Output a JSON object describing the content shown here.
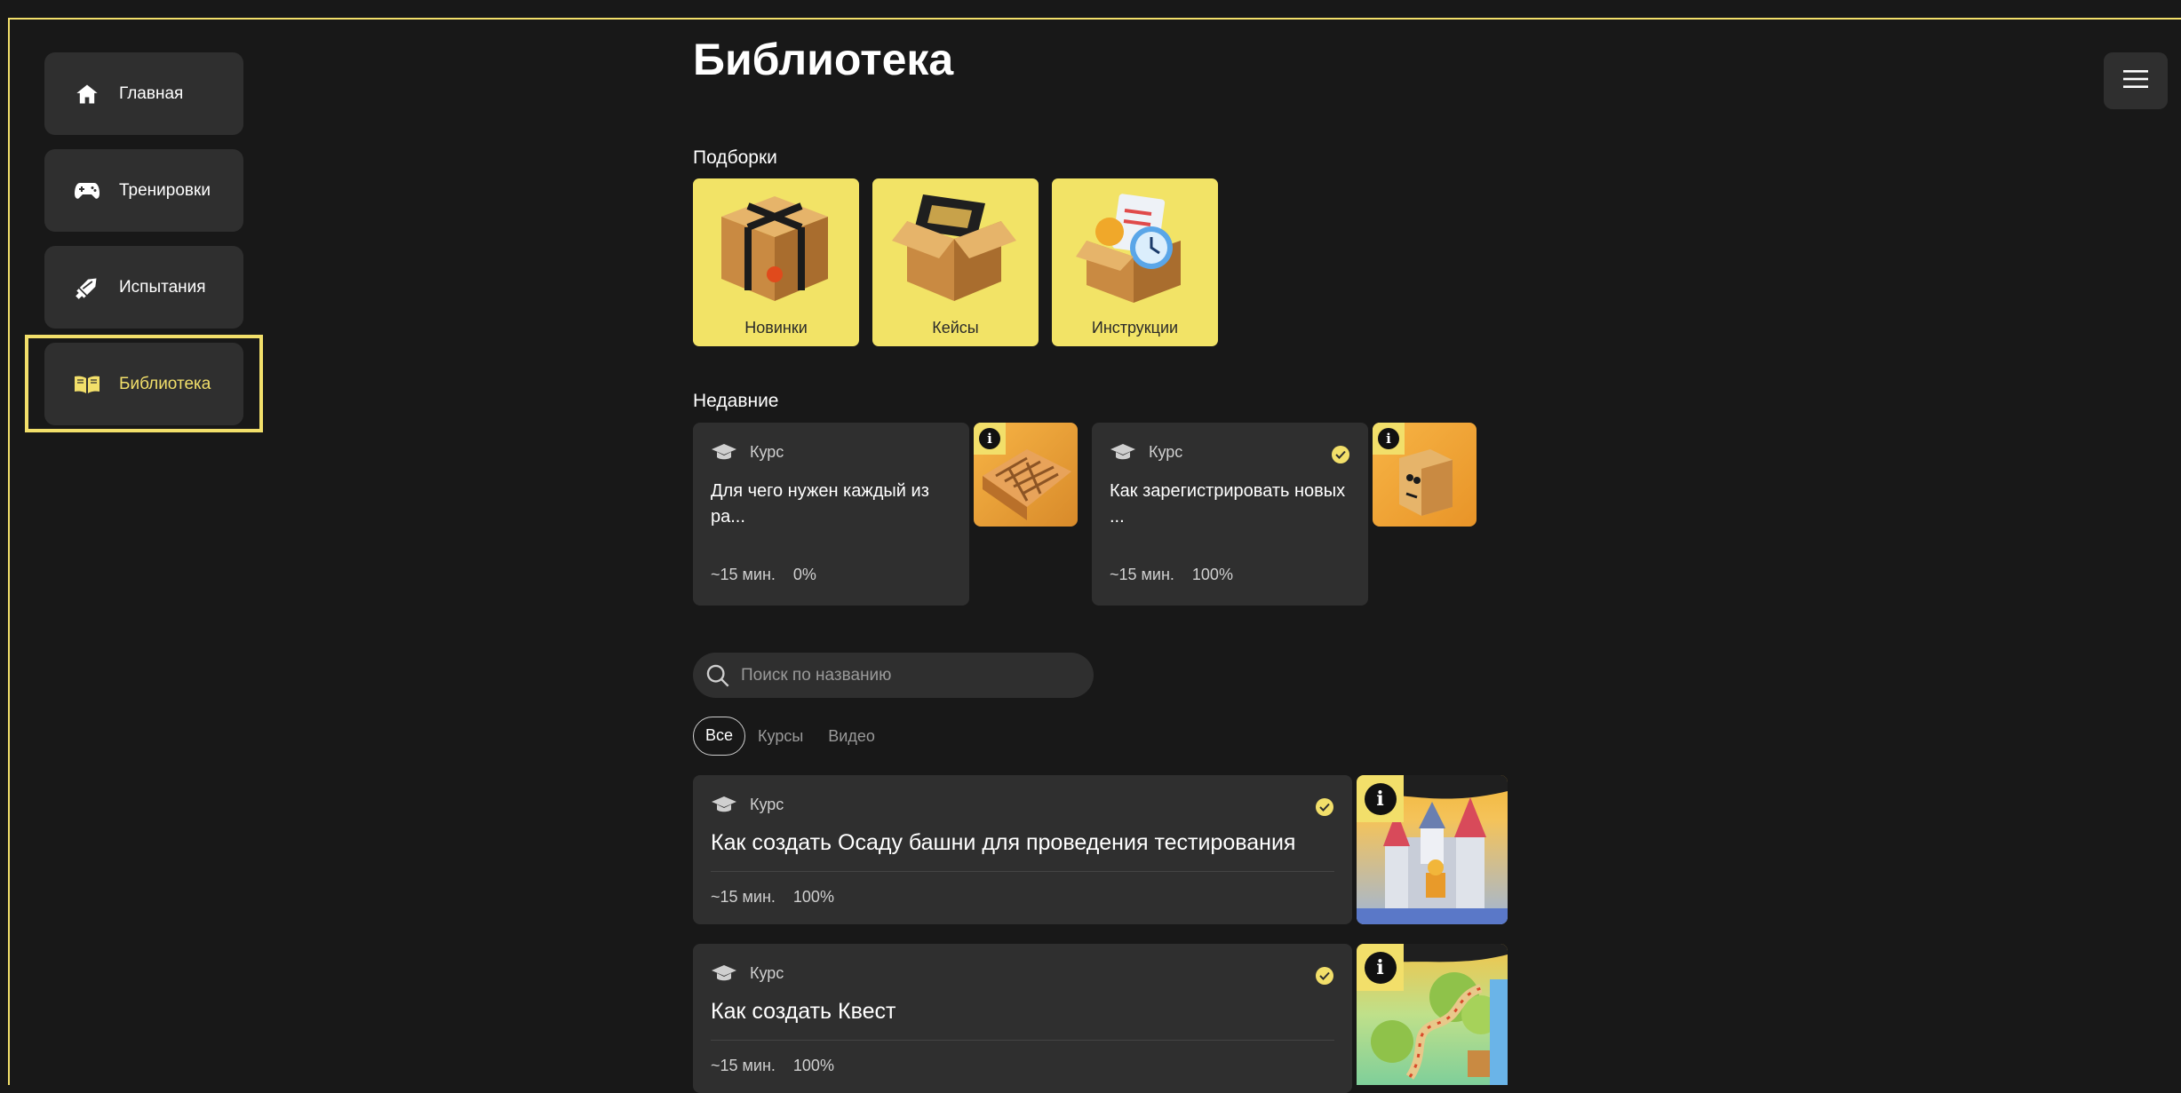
{
  "sidebar": {
    "items": [
      {
        "label": "Главная",
        "icon": "home-icon"
      },
      {
        "label": "Тренировки",
        "icon": "gamepad-icon"
      },
      {
        "label": "Испытания",
        "icon": "sword-icon"
      },
      {
        "label": "Библиотека",
        "icon": "book-icon",
        "active": true
      }
    ]
  },
  "header": {
    "menu_icon": "hamburger-menu-icon"
  },
  "main": {
    "title": "Библиотека",
    "collections": {
      "label": "Подборки",
      "items": [
        {
          "label": "Новинки",
          "icon": "sealed-box-icon"
        },
        {
          "label": "Кейсы",
          "icon": "open-box-icon"
        },
        {
          "label": "Инструкции",
          "icon": "instructions-box-icon"
        }
      ]
    },
    "recent": {
      "label": "Недавние",
      "items": [
        {
          "type": "Курс",
          "title": "Для чего нужен каждый из ра...",
          "duration": "~15 мин.",
          "progress": "0%",
          "completed": false
        },
        {
          "type": "Курс",
          "title": "Как зарегистрировать новых ...",
          "duration": "~15 мин.",
          "progress": "100%",
          "completed": true
        }
      ]
    },
    "search": {
      "placeholder": "Поиск по названию",
      "value": ""
    },
    "filters": {
      "items": [
        "Все",
        "Курсы",
        "Видео"
      ],
      "active": "Все"
    },
    "list": [
      {
        "type": "Курс",
        "title": "Как создать Осаду башни для проведения тестирования",
        "duration": "~15 мин.",
        "progress": "100%",
        "completed": true
      },
      {
        "type": "Курс",
        "title": "Как создать Квест",
        "duration": "~15 мин.",
        "progress": "100%",
        "completed": true
      }
    ],
    "info_badge": "i"
  },
  "colors": {
    "accent": "#f2df6a",
    "background": "#181818",
    "card": "#2f2f2f"
  }
}
